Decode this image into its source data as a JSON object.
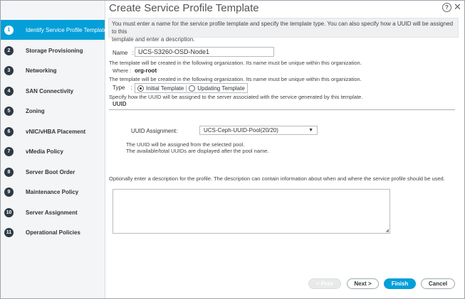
{
  "dialog": {
    "title": "Create Service Profile Template",
    "help_glyph": "?",
    "close_glyph": "✕"
  },
  "sidebar": {
    "items": [
      {
        "num": "1",
        "label": "Identify Service Profile Template",
        "active": true
      },
      {
        "num": "2",
        "label": "Storage Provisioning"
      },
      {
        "num": "3",
        "label": "Networking"
      },
      {
        "num": "4",
        "label": "SAN Connectivity"
      },
      {
        "num": "5",
        "label": "Zoning"
      },
      {
        "num": "6",
        "label": "vNIC/vHBA Placement"
      },
      {
        "num": "7",
        "label": "vMedia Policy"
      },
      {
        "num": "8",
        "label": "Server Boot Order"
      },
      {
        "num": "9",
        "label": "Maintenance Policy"
      },
      {
        "num": "10",
        "label": "Server Assignment"
      },
      {
        "num": "11",
        "label": "Operational Policies"
      }
    ]
  },
  "info": {
    "line1": "You must enter a name for the service profile template and specify the template type. You can also specify how a UUID will be assigned to this",
    "line2": "template and enter a description."
  },
  "form": {
    "name_label": "Name",
    "name_sep": ":",
    "name_value": "UCS-S3260-OSD-Node1",
    "name_help": "The template will be created in the following organization. Its name must be unique within this organization.",
    "where_label": "Where :",
    "where_value": "org-root",
    "type_help": "The template will be created in the following organization. Its name must be unique within this organization.",
    "type_label": "Type",
    "type_sep": ":",
    "type_options": [
      "Initial Template",
      "Updating Template"
    ],
    "uuid_help": "Specify how the UUID will be assigned to the server associated with the service generated by this template.",
    "uuid_heading": "UUID",
    "uuid_assignment_label": "UUID Assignment:",
    "uuid_assignment_value": "UCS-Ceph-UUID-Pool(20/20)",
    "uuid_note1": "The UUID will be assigned from the selected pool.",
    "uuid_note2": "The available/total UUIDs are displayed after the pool name.",
    "description_help": "Optionally enter a description for the profile. The description can contain information about when and where the service profile should be used.",
    "description_value": ""
  },
  "buttons": {
    "prev": "< Prev",
    "next": "Next >",
    "finish": "Finish",
    "cancel": "Cancel"
  },
  "colors": {
    "accent": "#049fd9",
    "step_badge": "#2e3a45"
  }
}
